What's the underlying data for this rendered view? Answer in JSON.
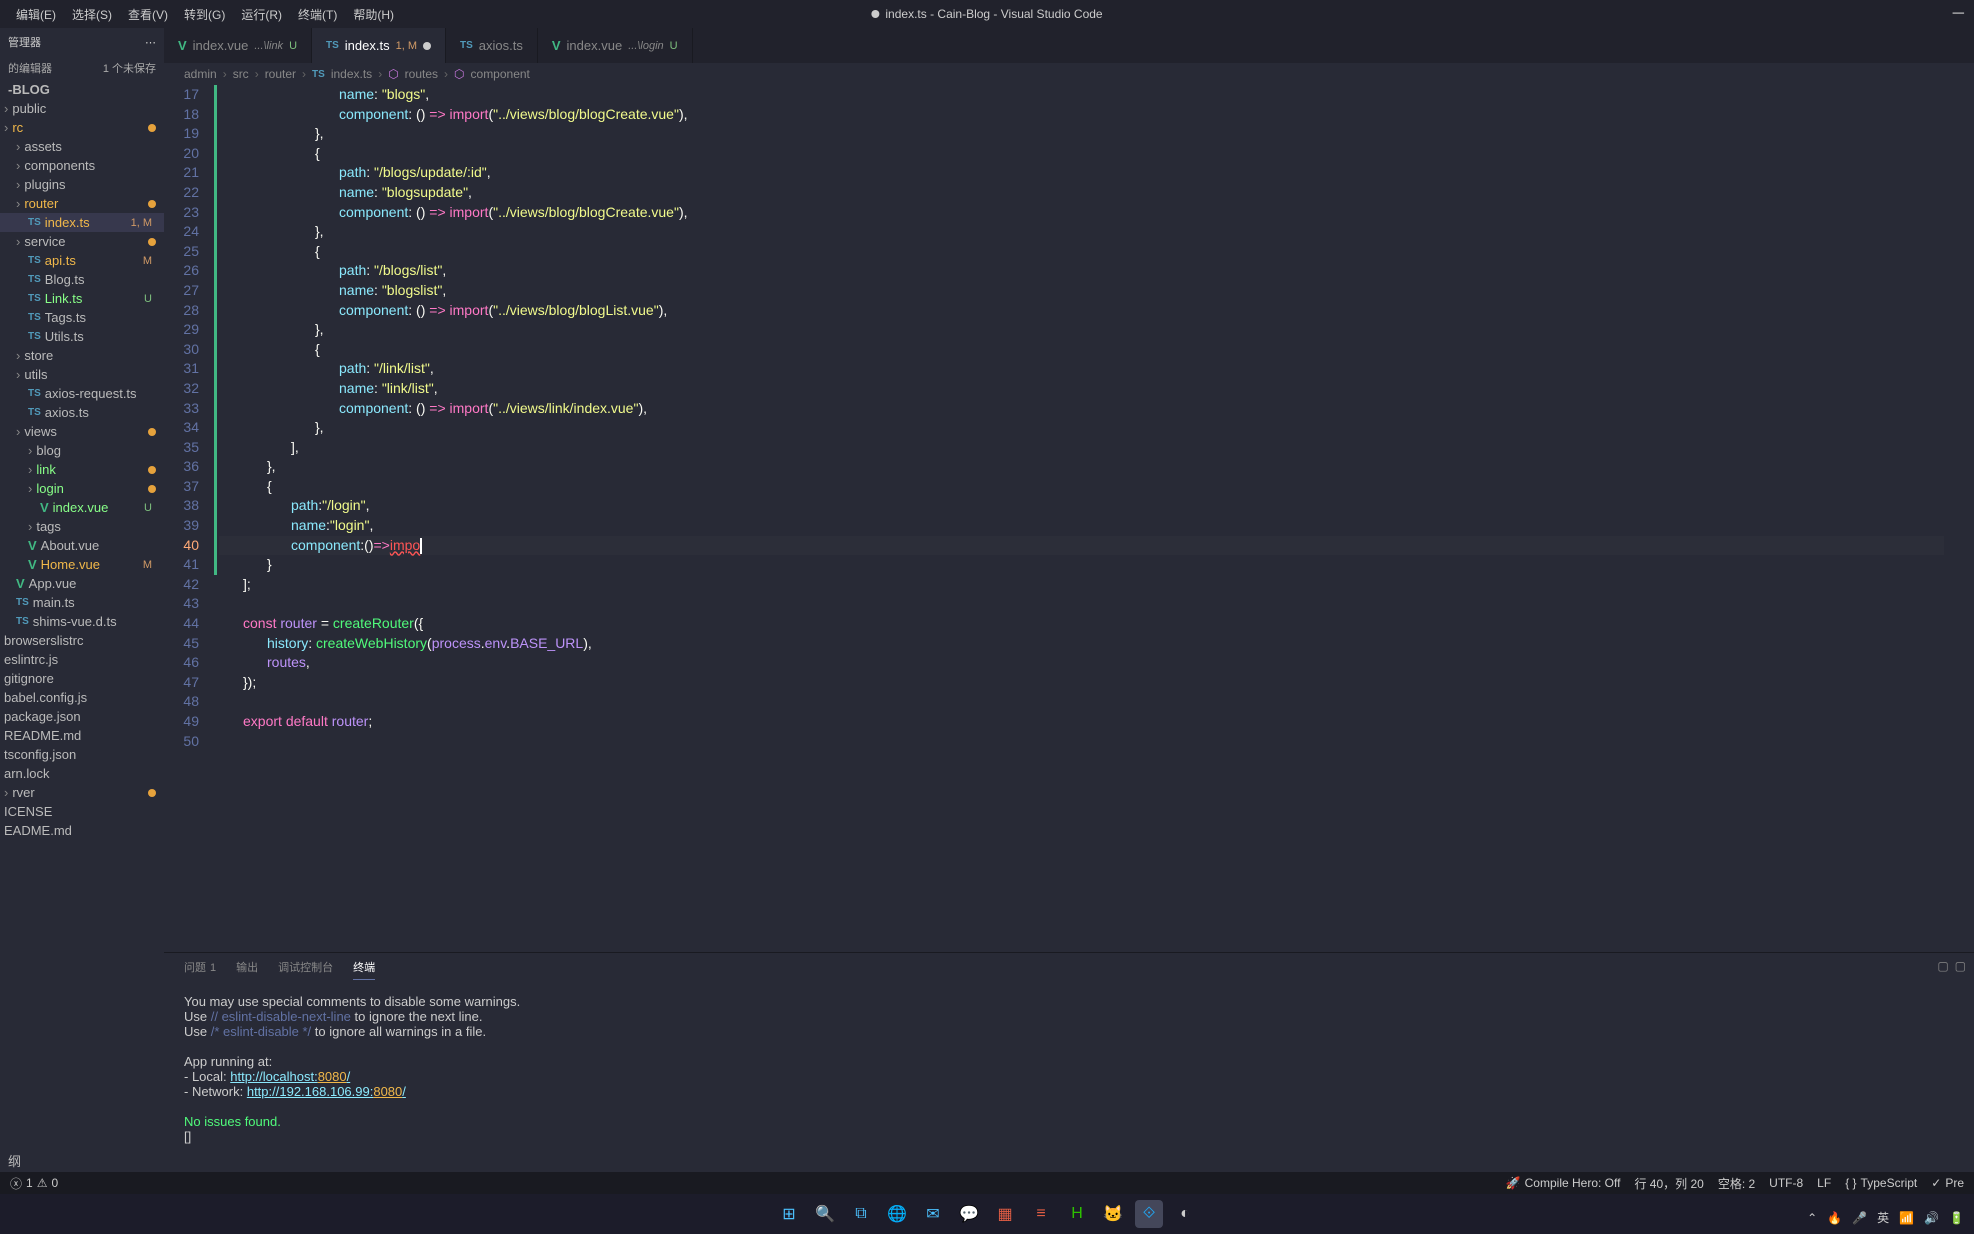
{
  "menu": {
    "items": [
      "编辑(E)",
      "选择(S)",
      "查看(V)",
      "转到(G)",
      "运行(R)",
      "终端(T)",
      "帮助(H)"
    ]
  },
  "window": {
    "title": "index.ts - Cain-Blog - Visual Studio Code",
    "modified": true
  },
  "explorer": {
    "title": "管理器",
    "section": "的编辑器",
    "unsaved": "1 个未保存",
    "root": "-BLOG",
    "tree": [
      {
        "label": "public",
        "type": "folder",
        "indent": 0
      },
      {
        "label": "rc",
        "type": "folder",
        "indent": 0,
        "modified": true,
        "color": "orange"
      },
      {
        "label": "assets",
        "type": "folder",
        "indent": 1
      },
      {
        "label": "components",
        "type": "folder",
        "indent": 1
      },
      {
        "label": "plugins",
        "type": "folder",
        "indent": 1
      },
      {
        "label": "router",
        "type": "folder",
        "indent": 1,
        "modified": true,
        "color": "orange"
      },
      {
        "label": "index.ts",
        "type": "file",
        "indent": 2,
        "status": "1, M",
        "active": true,
        "color": "orange"
      },
      {
        "label": "service",
        "type": "folder",
        "indent": 1,
        "modified": true
      },
      {
        "label": "api.ts",
        "type": "file",
        "indent": 2,
        "status": "M",
        "color": "orange"
      },
      {
        "label": "Blog.ts",
        "type": "file",
        "indent": 2
      },
      {
        "label": "Link.ts",
        "type": "file",
        "indent": 2,
        "status": "U",
        "color": "green"
      },
      {
        "label": "Tags.ts",
        "type": "file",
        "indent": 2
      },
      {
        "label": "Utils.ts",
        "type": "file",
        "indent": 2
      },
      {
        "label": "store",
        "type": "folder",
        "indent": 1
      },
      {
        "label": "utils",
        "type": "folder",
        "indent": 1
      },
      {
        "label": "axios-request.ts",
        "type": "file",
        "indent": 2
      },
      {
        "label": "axios.ts",
        "type": "file",
        "indent": 2
      },
      {
        "label": "views",
        "type": "folder",
        "indent": 1,
        "modified": true
      },
      {
        "label": "blog",
        "type": "folder",
        "indent": 2
      },
      {
        "label": "link",
        "type": "folder",
        "indent": 2,
        "modified": true,
        "color": "green"
      },
      {
        "label": "login",
        "type": "folder",
        "indent": 2,
        "modified": true,
        "color": "green"
      },
      {
        "label": "index.vue",
        "type": "file",
        "indent": 3,
        "status": "U",
        "color": "green",
        "vue": true
      },
      {
        "label": "tags",
        "type": "folder",
        "indent": 2
      },
      {
        "label": "About.vue",
        "type": "file",
        "indent": 2,
        "vue": true
      },
      {
        "label": "Home.vue",
        "type": "file",
        "indent": 2,
        "status": "M",
        "vue": true,
        "color": "orange"
      },
      {
        "label": "App.vue",
        "type": "file",
        "indent": 1,
        "vue": true
      },
      {
        "label": "main.ts",
        "type": "file",
        "indent": 1
      },
      {
        "label": "shims-vue.d.ts",
        "type": "file",
        "indent": 1
      },
      {
        "label": "browserslistrc",
        "type": "file",
        "indent": 0
      },
      {
        "label": "eslintrc.js",
        "type": "file",
        "indent": 0
      },
      {
        "label": "gitignore",
        "type": "file",
        "indent": 0
      },
      {
        "label": "babel.config.js",
        "type": "file",
        "indent": 0
      },
      {
        "label": "package.json",
        "type": "file",
        "indent": 0
      },
      {
        "label": "README.md",
        "type": "file",
        "indent": 0
      },
      {
        "label": "tsconfig.json",
        "type": "file",
        "indent": 0
      },
      {
        "label": "arn.lock",
        "type": "file",
        "indent": 0
      },
      {
        "label": "rver",
        "type": "folder",
        "indent": 0,
        "modified": true
      },
      {
        "label": "ICENSE",
        "type": "file",
        "indent": 0
      },
      {
        "label": "EADME.md",
        "type": "file",
        "indent": 0
      }
    ],
    "outline": "纲"
  },
  "tabs": [
    {
      "name": "index.vue",
      "icon": "vue",
      "folder": "...\\link",
      "status": "U"
    },
    {
      "name": "index.ts",
      "icon": "ts",
      "status": "1, M",
      "active": true,
      "modified": true
    },
    {
      "name": "axios.ts",
      "icon": "ts"
    },
    {
      "name": "index.vue",
      "icon": "vue",
      "folder": "...\\login",
      "status": "U"
    }
  ],
  "breadcrumb": {
    "parts": [
      "admin",
      "src",
      "router",
      "index.ts",
      "routes",
      "component"
    ]
  },
  "code": {
    "startLine": 17,
    "activeLine": 40,
    "lines": [
      {
        "n": 17,
        "indent": 5,
        "tokens": [
          [
            "prop",
            "name"
          ],
          [
            "punc",
            ": "
          ],
          [
            "str",
            "\"blogs\""
          ],
          [
            "punc",
            ","
          ]
        ]
      },
      {
        "n": 18,
        "indent": 5,
        "tokens": [
          [
            "prop",
            "component"
          ],
          [
            "punc",
            ": () "
          ],
          [
            "key",
            "=>"
          ],
          [
            "punc",
            " "
          ],
          [
            "key",
            "import"
          ],
          [
            "punc",
            "("
          ],
          [
            "str",
            "\"../views/blog/blogCreate.vue\""
          ],
          [
            "punc",
            "),"
          ]
        ]
      },
      {
        "n": 19,
        "indent": 4,
        "tokens": [
          [
            "punc",
            "},"
          ]
        ]
      },
      {
        "n": 20,
        "indent": 4,
        "tokens": [
          [
            "punc",
            "{"
          ]
        ]
      },
      {
        "n": 21,
        "indent": 5,
        "tokens": [
          [
            "prop",
            "path"
          ],
          [
            "punc",
            ": "
          ],
          [
            "str",
            "\"/blogs/update/:id\""
          ],
          [
            "punc",
            ","
          ]
        ]
      },
      {
        "n": 22,
        "indent": 5,
        "tokens": [
          [
            "prop",
            "name"
          ],
          [
            "punc",
            ": "
          ],
          [
            "str",
            "\"blogsupdate\""
          ],
          [
            "punc",
            ","
          ]
        ]
      },
      {
        "n": 23,
        "indent": 5,
        "tokens": [
          [
            "prop",
            "component"
          ],
          [
            "punc",
            ": () "
          ],
          [
            "key",
            "=>"
          ],
          [
            "punc",
            " "
          ],
          [
            "key",
            "import"
          ],
          [
            "punc",
            "("
          ],
          [
            "str",
            "\"../views/blog/blogCreate.vue\""
          ],
          [
            "punc",
            "),"
          ]
        ]
      },
      {
        "n": 24,
        "indent": 4,
        "tokens": [
          [
            "punc",
            "},"
          ]
        ]
      },
      {
        "n": 25,
        "indent": 4,
        "tokens": [
          [
            "punc",
            "{"
          ]
        ]
      },
      {
        "n": 26,
        "indent": 5,
        "tokens": [
          [
            "prop",
            "path"
          ],
          [
            "punc",
            ": "
          ],
          [
            "str",
            "\"/blogs/list\""
          ],
          [
            "punc",
            ","
          ]
        ]
      },
      {
        "n": 27,
        "indent": 5,
        "tokens": [
          [
            "prop",
            "name"
          ],
          [
            "punc",
            ": "
          ],
          [
            "str",
            "\"blogslist\""
          ],
          [
            "punc",
            ","
          ]
        ]
      },
      {
        "n": 28,
        "indent": 5,
        "tokens": [
          [
            "prop",
            "component"
          ],
          [
            "punc",
            ": () "
          ],
          [
            "key",
            "=>"
          ],
          [
            "punc",
            " "
          ],
          [
            "key",
            "import"
          ],
          [
            "punc",
            "("
          ],
          [
            "str",
            "\"../views/blog/blogList.vue\""
          ],
          [
            "punc",
            "),"
          ]
        ]
      },
      {
        "n": 29,
        "indent": 4,
        "tokens": [
          [
            "punc",
            "},"
          ]
        ]
      },
      {
        "n": 30,
        "indent": 4,
        "tokens": [
          [
            "punc",
            "{"
          ]
        ]
      },
      {
        "n": 31,
        "indent": 5,
        "tokens": [
          [
            "prop",
            "path"
          ],
          [
            "punc",
            ": "
          ],
          [
            "str",
            "\"/link/list\""
          ],
          [
            "punc",
            ","
          ]
        ]
      },
      {
        "n": 32,
        "indent": 5,
        "tokens": [
          [
            "prop",
            "name"
          ],
          [
            "punc",
            ": "
          ],
          [
            "str",
            "\"link/list\""
          ],
          [
            "punc",
            ","
          ]
        ]
      },
      {
        "n": 33,
        "indent": 5,
        "tokens": [
          [
            "prop",
            "component"
          ],
          [
            "punc",
            ": () "
          ],
          [
            "key",
            "=>"
          ],
          [
            "punc",
            " "
          ],
          [
            "key",
            "import"
          ],
          [
            "punc",
            "("
          ],
          [
            "str",
            "\"../views/link/index.vue\""
          ],
          [
            "punc",
            "),"
          ]
        ]
      },
      {
        "n": 34,
        "indent": 4,
        "tokens": [
          [
            "punc",
            "},"
          ]
        ]
      },
      {
        "n": 35,
        "indent": 3,
        "tokens": [
          [
            "punc",
            "],"
          ]
        ]
      },
      {
        "n": 36,
        "indent": 2,
        "tokens": [
          [
            "punc",
            "},"
          ]
        ]
      },
      {
        "n": 37,
        "indent": 2,
        "tokens": [
          [
            "punc",
            "{"
          ]
        ]
      },
      {
        "n": 38,
        "indent": 3,
        "tokens": [
          [
            "prop",
            "path"
          ],
          [
            "punc",
            ":"
          ],
          [
            "str",
            "\"/login\""
          ],
          [
            "punc",
            ","
          ]
        ]
      },
      {
        "n": 39,
        "indent": 3,
        "tokens": [
          [
            "prop",
            "name"
          ],
          [
            "punc",
            ":"
          ],
          [
            "str",
            "\"login\""
          ],
          [
            "punc",
            ","
          ]
        ]
      },
      {
        "n": 40,
        "indent": 3,
        "tokens": [
          [
            "prop",
            "component"
          ],
          [
            "punc",
            ":()"
          ],
          [
            "key",
            "=>"
          ],
          [
            "err",
            "impo"
          ]
        ],
        "cursor": true
      },
      {
        "n": 41,
        "indent": 2,
        "tokens": [
          [
            "punc",
            "}"
          ]
        ]
      },
      {
        "n": 42,
        "indent": 1,
        "tokens": [
          [
            "punc",
            "];"
          ]
        ]
      },
      {
        "n": 43,
        "indent": 0,
        "tokens": []
      },
      {
        "n": 44,
        "indent": 1,
        "tokens": [
          [
            "key",
            "const "
          ],
          [
            "var",
            "router"
          ],
          [
            "punc",
            " = "
          ],
          [
            "func",
            "createRouter"
          ],
          [
            "punc",
            "({"
          ]
        ]
      },
      {
        "n": 45,
        "indent": 2,
        "tokens": [
          [
            "prop",
            "history"
          ],
          [
            "punc",
            ": "
          ],
          [
            "func",
            "createWebHistory"
          ],
          [
            "punc",
            "("
          ],
          [
            "var",
            "process"
          ],
          [
            "punc",
            "."
          ],
          [
            "var",
            "env"
          ],
          [
            "punc",
            "."
          ],
          [
            "const",
            "BASE_URL"
          ],
          [
            "punc",
            "),"
          ]
        ]
      },
      {
        "n": 46,
        "indent": 2,
        "tokens": [
          [
            "var",
            "routes"
          ],
          [
            "punc",
            ","
          ]
        ]
      },
      {
        "n": 47,
        "indent": 1,
        "tokens": [
          [
            "punc",
            "});"
          ]
        ]
      },
      {
        "n": 48,
        "indent": 0,
        "tokens": []
      },
      {
        "n": 49,
        "indent": 1,
        "tokens": [
          [
            "key",
            "export "
          ],
          [
            "key",
            "default "
          ],
          [
            "var",
            "router"
          ],
          [
            "punc",
            ";"
          ]
        ]
      },
      {
        "n": 50,
        "indent": 0,
        "tokens": []
      }
    ]
  },
  "panel": {
    "tabs": {
      "problems": "问题",
      "problemsBadge": "1",
      "output": "输出",
      "debug": "调试控制台",
      "terminal": "终端"
    },
    "terminal": {
      "l1": "You may use special comments to disable some warnings.",
      "l2a": "Use ",
      "l2b": "// eslint-disable-next-line",
      "l2c": " to ignore the next line.",
      "l3a": "Use ",
      "l3b": "/* eslint-disable */",
      "l3c": " to ignore all warnings in a file.",
      "l4": "  App running at:",
      "l5a": "  - Local:   ",
      "l5url": "http://localhost:",
      "l5port": "8080",
      "l5slash": "/",
      "l6a": "  - Network: ",
      "l6url": "http://192.168.106.99:",
      "l6port": "8080",
      "l6slash": "/",
      "l7": "No issues found.",
      "l8": "[]"
    }
  },
  "status": {
    "errors": "1",
    "warnings": "0",
    "compile": "Compile Hero: Off",
    "pos": "行 40，列 20",
    "spaces": "空格: 2",
    "encoding": "UTF-8",
    "eol": "LF",
    "lang": "TypeScript",
    "prettier": "Pre"
  },
  "systray": {
    "ime": "英"
  }
}
